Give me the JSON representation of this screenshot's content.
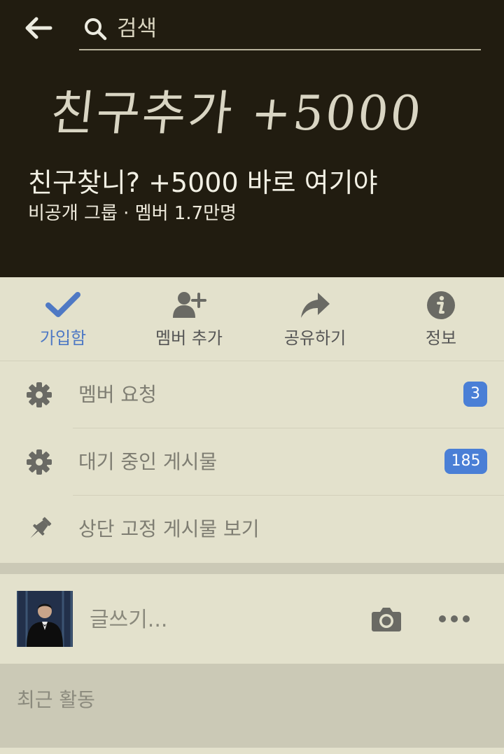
{
  "search": {
    "placeholder": "검색"
  },
  "group": {
    "cover_text": "친구추가 +5000",
    "title": "친구찾니? +5000 바로 여기야",
    "meta": "비공개 그룹 · 멤버 1.7만명"
  },
  "actions": [
    {
      "label": "가입함",
      "icon": "check-icon",
      "active": true
    },
    {
      "label": "멤버 추가",
      "icon": "add-member-icon"
    },
    {
      "label": "공유하기",
      "icon": "share-icon"
    },
    {
      "label": "정보",
      "icon": "info-icon"
    }
  ],
  "menu": [
    {
      "label": "멤버 요청",
      "icon": "gear-icon",
      "badge": "3"
    },
    {
      "label": "대기 중인 게시물",
      "icon": "gear-icon",
      "badge": "185"
    },
    {
      "label": "상단 고정 게시물 보기",
      "icon": "pin-icon"
    }
  ],
  "composer": {
    "placeholder": "글쓰기..."
  },
  "recent": {
    "label": "최근 활동"
  },
  "colors": {
    "header_bg": "#211c10",
    "page_bg": "#e3e1cc",
    "accent": "#4f79c4",
    "badge_bg": "#4a7fd6"
  }
}
